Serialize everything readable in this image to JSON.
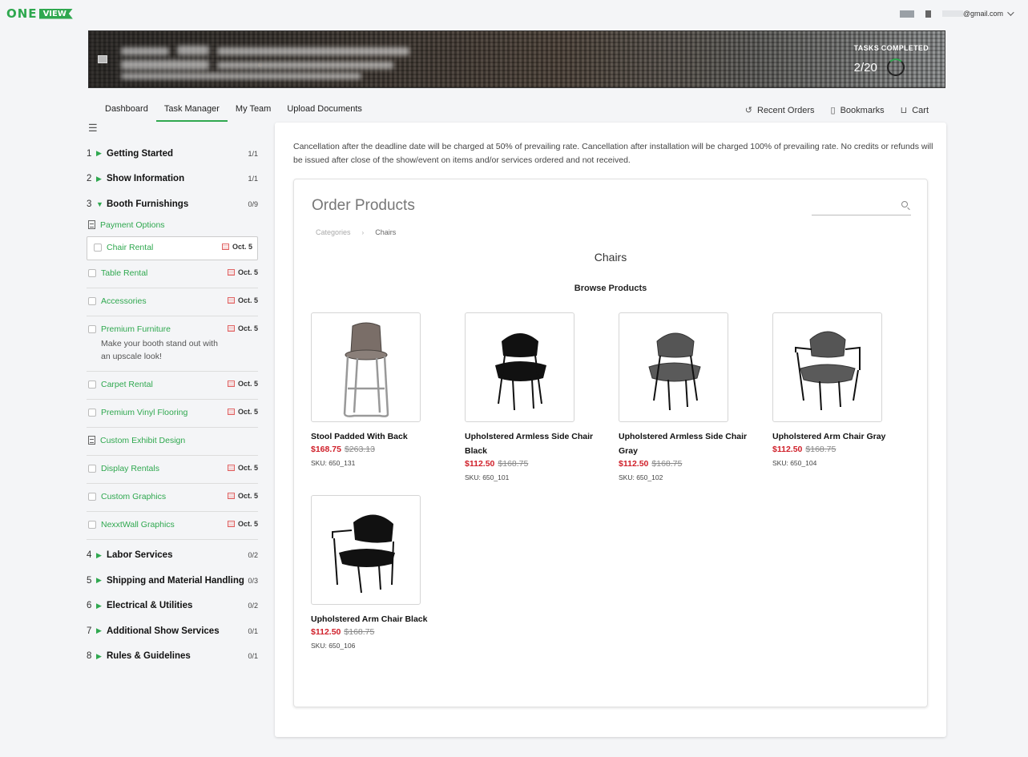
{
  "app": {
    "logo_one": "ONE",
    "logo_view": "VIEW"
  },
  "account": {
    "email": "@gmail.com"
  },
  "banner": {
    "tasks_label": "TASKS COMPLETED",
    "tasks_count": "2/20",
    "tasks_progress": 0.1
  },
  "nav": {
    "tabs": [
      "Dashboard",
      "Task Manager",
      "My Team",
      "Upload Documents"
    ],
    "active_tab": "Task Manager",
    "right_links": {
      "recent_orders": "Recent Orders",
      "bookmarks": "Bookmarks",
      "cart": "Cart"
    }
  },
  "sidebar": {
    "sections_top": [
      {
        "num": "1",
        "name": "Getting Started",
        "count": "1/1"
      },
      {
        "num": "2",
        "name": "Show Information",
        "count": "1/1"
      },
      {
        "num": "3",
        "name": "Booth Furnishings",
        "count": "0/9"
      }
    ],
    "payment_options": "Payment Options",
    "tasks": [
      {
        "name": "Chair Rental",
        "date": "Oct. 5"
      },
      {
        "name": "Table Rental",
        "date": "Oct. 5"
      },
      {
        "name": "Accessories",
        "date": "Oct. 5"
      },
      {
        "name": "Premium Furniture",
        "date": "Oct. 5",
        "desc": "Make your booth stand out with an upscale look!"
      },
      {
        "name": "Carpet Rental",
        "date": "Oct. 5"
      },
      {
        "name": "Premium Vinyl Flooring",
        "date": "Oct. 5"
      },
      {
        "name": "Custom Exhibit Design",
        "date": ""
      },
      {
        "name": "Display Rentals",
        "date": "Oct. 5"
      },
      {
        "name": "Custom Graphics",
        "date": "Oct. 5"
      },
      {
        "name": "NexxtWall Graphics",
        "date": "Oct. 5"
      }
    ],
    "sections_bottom": [
      {
        "num": "4",
        "name": "Labor Services",
        "count": "0/2"
      },
      {
        "num": "5",
        "name": "Shipping and Material Handling",
        "count": "0/3"
      },
      {
        "num": "6",
        "name": "Electrical & Utilities",
        "count": "0/2"
      },
      {
        "num": "7",
        "name": "Additional Show Services",
        "count": "0/1"
      },
      {
        "num": "8",
        "name": "Rules & Guidelines",
        "count": "0/1"
      }
    ]
  },
  "main": {
    "notice": "Cancellation after the deadline date will be charged at 50% of prevailing rate. Cancellation after installation will be charged 100% of prevailing rate. No credits or refunds will be issued after close of the show/event on items and/or services ordered and not received.",
    "title": "Order Products",
    "search_placeholder": "",
    "breadcrumb": {
      "root": "Categories",
      "current": "Chairs"
    },
    "category_title": "Chairs",
    "browse_label": "Browse Products",
    "products": [
      {
        "name": "Stool Padded With Back",
        "price": "$168.75",
        "old_price": "$263.13",
        "sku": "SKU: 650_131"
      },
      {
        "name": "Upholstered Armless Side Chair Black",
        "price": "$112.50",
        "old_price": "$168.75",
        "sku": "SKU: 650_101"
      },
      {
        "name": "Upholstered Armless Side Chair Gray",
        "price": "$112.50",
        "old_price": "$168.75",
        "sku": "SKU: 650_102"
      },
      {
        "name": "Upholstered Arm Chair Gray",
        "price": "$112.50",
        "old_price": "$168.75",
        "sku": "SKU: 650_104"
      },
      {
        "name": "Upholstered Arm Chair Black",
        "price": "$112.50",
        "old_price": "$168.75",
        "sku": "SKU: 650_106"
      }
    ]
  },
  "colors": {
    "accent": "#2fa84f",
    "price": "#d0202a"
  }
}
